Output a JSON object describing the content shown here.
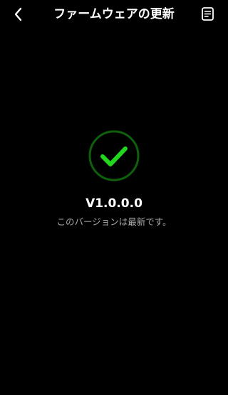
{
  "header": {
    "title": "ファームウェアの更新",
    "back_icon": "chevron-left-icon",
    "doc_icon": "document-icon"
  },
  "status": {
    "icon": "checkmark-circle-icon",
    "accent_color": "#22d51d",
    "ring_color": "#0f5f0d",
    "version": "V1.0.0.0",
    "message": "このバージョンは最新です。"
  }
}
